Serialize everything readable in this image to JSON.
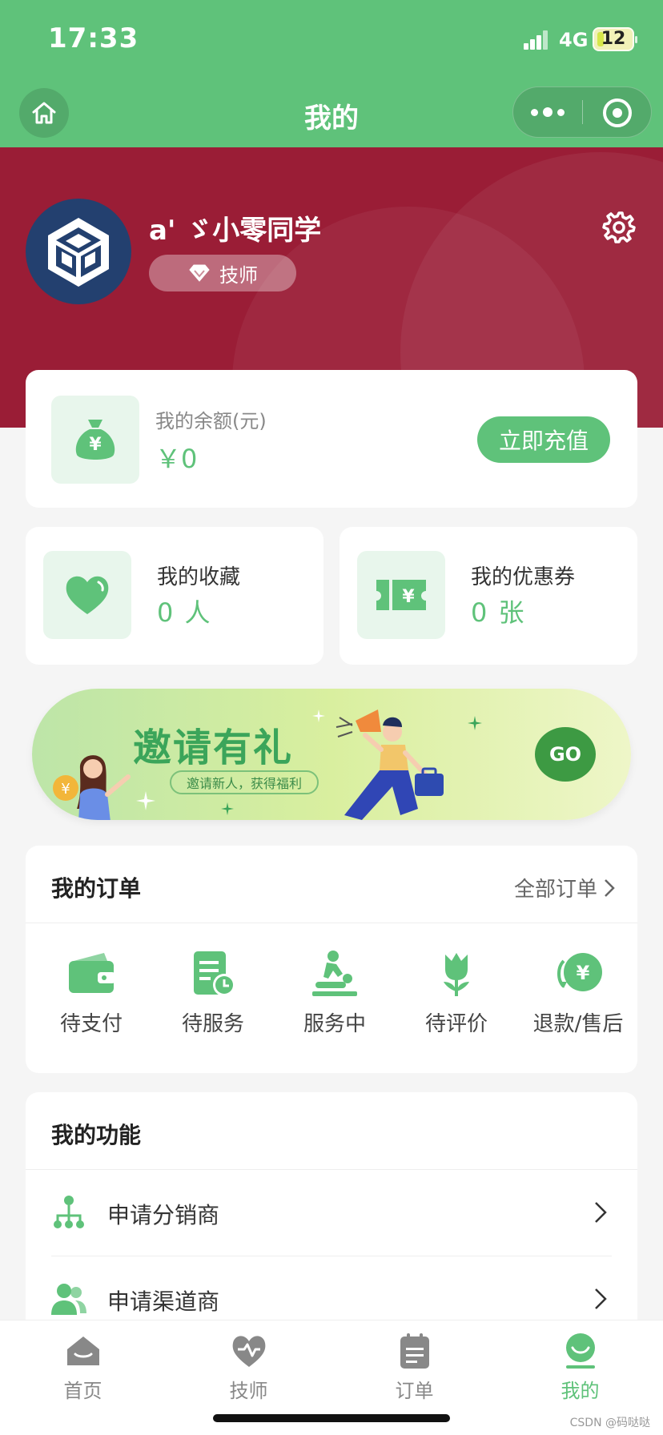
{
  "status_bar": {
    "time": "17:33",
    "network": "4G",
    "battery": "12"
  },
  "nav": {
    "title": "我的"
  },
  "profile": {
    "username": "a' ゞ小零同学",
    "role_badge": "技师"
  },
  "balance": {
    "label": "我的余额(元)",
    "value": "￥0",
    "recharge_button": "立即充值"
  },
  "favorites": {
    "label": "我的收藏",
    "value": "0 人"
  },
  "coupons": {
    "label": "我的优惠券",
    "value": "0 张"
  },
  "invite_banner": {
    "title": "邀请有礼",
    "subtitle": "邀请新人，获得福利",
    "go_button": "GO"
  },
  "orders": {
    "title": "我的订单",
    "all_link": "全部订单",
    "items": [
      {
        "label": "待支付",
        "icon": "wallet-icon"
      },
      {
        "label": "待服务",
        "icon": "service-schedule-icon"
      },
      {
        "label": "服务中",
        "icon": "massage-icon"
      },
      {
        "label": "待评价",
        "icon": "flower-review-icon"
      },
      {
        "label": "退款/售后",
        "icon": "refund-icon"
      }
    ]
  },
  "functions": {
    "title": "我的功能",
    "items": [
      {
        "label": "申请分销商",
        "icon": "distribution-tree-icon"
      },
      {
        "label": "申请渠道商",
        "icon": "users-icon"
      }
    ]
  },
  "tabbar": {
    "items": [
      {
        "label": "首页",
        "icon": "home-icon",
        "active": false
      },
      {
        "label": "技师",
        "icon": "heart-pulse-icon",
        "active": false
      },
      {
        "label": "订单",
        "icon": "order-list-icon",
        "active": false
      },
      {
        "label": "我的",
        "icon": "smile-icon",
        "active": true
      }
    ]
  },
  "watermark": "CSDN @码哒哒",
  "colors": {
    "primary_green": "#5fc27a",
    "profile_bg": "#9a1d36",
    "avatar_bg": "#23406f",
    "page_bg": "#f5f5f5"
  }
}
